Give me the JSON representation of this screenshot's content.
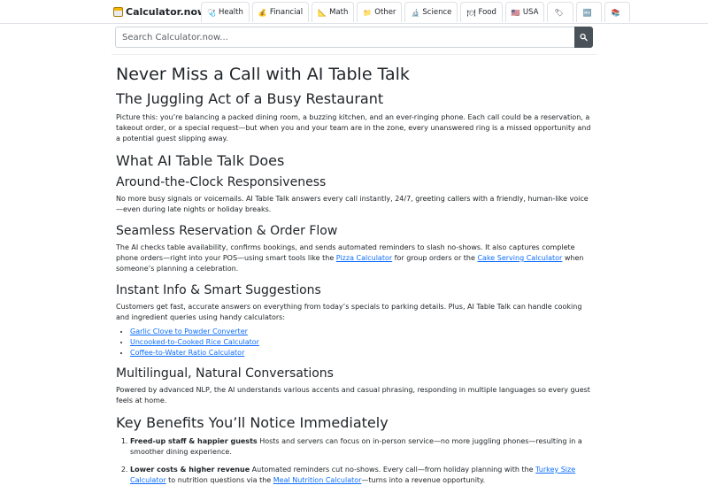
{
  "brand": {
    "name": "Calculator.now"
  },
  "tabs": [
    {
      "icon": "🩺",
      "label": "Health"
    },
    {
      "icon": "💰",
      "label": "Financial"
    },
    {
      "icon": "📐",
      "label": "Math"
    },
    {
      "icon": "📁",
      "label": "Other"
    },
    {
      "icon": "🔬",
      "label": "Science"
    },
    {
      "icon": "🍽",
      "label": "Food"
    },
    {
      "icon": "🇺🇸",
      "label": "USA"
    },
    {
      "icon": "🏷",
      "label": ""
    },
    {
      "icon": "🔤",
      "label": ""
    },
    {
      "icon": "📚",
      "label": ""
    }
  ],
  "search": {
    "placeholder": "Search Calculator.now..."
  },
  "article": {
    "title": "Never Miss a Call with AI Table Talk",
    "s1_heading": "The Juggling Act of a Busy Restaurant",
    "s1_p": "Picture this: you’re balancing a packed dining room, a buzzing kitchen, and an ever-ringing phone. Each call could be a reservation, a takeout order, or a special request—but when you and your team are in the zone, every unanswered ring is a missed opportunity and a potential guest slipping away.",
    "s2_heading": "What AI Table Talk Does",
    "s2a_heading": "Around-the-Clock Responsiveness",
    "s2a_p": "No more busy signals or voicemails. AI Table Talk answers every call instantly, 24/7, greeting callers with a friendly, human-like voice—even during late nights or holiday breaks.",
    "s2b_heading": "Seamless Reservation & Order Flow",
    "s2b_p_before": "The AI checks table availability, confirms bookings, and sends automated reminders to slash no-shows. It also captures complete phone orders—right into your POS—using smart tools like the ",
    "s2b_link1": "Pizza Calculator",
    "s2b_p_mid": " for group orders or the ",
    "s2b_link2": "Cake Serving Calculator",
    "s2b_p_after": " when someone’s planning a celebration.",
    "s2c_heading": "Instant Info & Smart Suggestions",
    "s2c_p": "Customers get fast, accurate answers on everything from today’s specials to parking details. Plus, AI Table Talk can handle cooking and ingredient queries using handy calculators:",
    "s2c_links": [
      "Garlic Clove to Powder Converter",
      "Uncooked-to-Cooked Rice Calculator",
      "Coffee-to-Water Ratio Calculator"
    ],
    "s2d_heading": "Multilingual, Natural Conversations",
    "s2d_p": "Powered by advanced NLP, the AI understands various accents and casual phrasing, responding in multiple languages so every guest feels at home.",
    "s3_heading": "Key Benefits You’ll Notice Immediately",
    "b1_title": "Freed-up staff & happier guests",
    "b1_text": " Hosts and servers can focus on in-person service—no more juggling phones—resulting in a smoother dining experience.",
    "b2_title": "Lower costs & higher revenue",
    "b2_text": " Automated reminders cut no-shows. Every call—from holiday planning with the ",
    "b2_link1": "Turkey Size Calculator",
    "b2_text2": " to nutrition questions via the ",
    "b2_link2": "Meal Nutrition Calculator",
    "b2_text3": "—turns into a revenue opportunity."
  }
}
